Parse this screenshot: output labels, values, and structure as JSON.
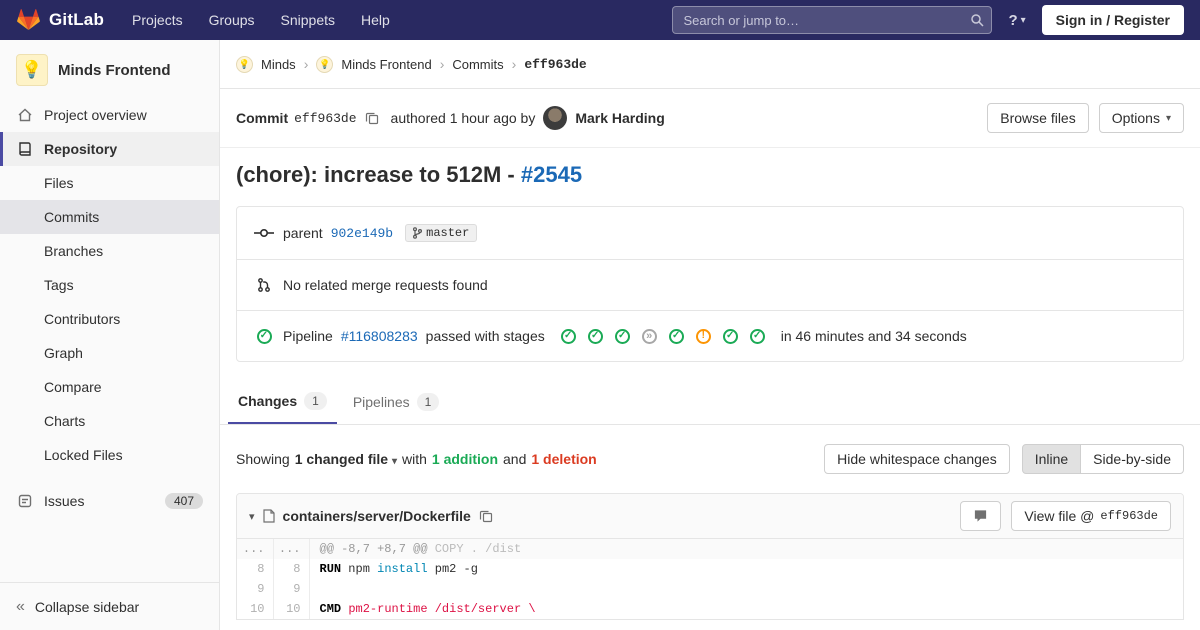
{
  "icons": {
    "caret_down": "▾",
    "collapse": "«",
    "help": "?"
  },
  "navbar": {
    "logo_text": "GitLab",
    "menu": [
      "Projects",
      "Groups",
      "Snippets",
      "Help"
    ],
    "search_placeholder": "Search or jump to…",
    "sign_in_label": "Sign in / Register"
  },
  "sidebar": {
    "project_avatar": "💡",
    "project_name": "Minds Frontend",
    "overview_label": "Project overview",
    "repository_label": "Repository",
    "repo_items": [
      "Files",
      "Commits",
      "Branches",
      "Tags",
      "Contributors",
      "Graph",
      "Compare",
      "Charts",
      "Locked Files"
    ],
    "active_repo_item": "Commits",
    "issues_label": "Issues",
    "issues_count": "407",
    "collapse_label": "Collapse sidebar"
  },
  "breadcrumb": {
    "avatar_glyph": "💡",
    "items": [
      "Minds",
      "Minds Frontend",
      "Commits"
    ],
    "current": "eff963de",
    "separator": "›"
  },
  "commit": {
    "label": "Commit",
    "sha": "eff963de",
    "authored_text": "authored 1 hour ago by",
    "author": "Mark Harding",
    "browse_files_label": "Browse files",
    "options_label": "Options",
    "title": "(chore): increase to 512M - ",
    "title_link": "#2545",
    "parent_label": "parent",
    "parent_sha": "902e149b",
    "branch_ref": "master",
    "no_mr_text": "No related merge requests found",
    "pipeline": {
      "status_glyph": "✓",
      "prefix": "Pipeline",
      "id": "#116808283",
      "status_text": "passed with stages",
      "stages": [
        {
          "status": "passed",
          "glyph": "✓"
        },
        {
          "status": "passed",
          "glyph": "✓"
        },
        {
          "status": "passed",
          "glyph": "✓"
        },
        {
          "status": "skipped",
          "glyph": "»"
        },
        {
          "status": "passed",
          "glyph": "✓"
        },
        {
          "status": "warning",
          "glyph": "!"
        },
        {
          "status": "passed",
          "glyph": "✓"
        },
        {
          "status": "passed",
          "glyph": "✓"
        }
      ],
      "duration": "in 46 minutes and 34 seconds"
    }
  },
  "tabs": {
    "changes_label": "Changes",
    "changes_count": "1",
    "pipelines_label": "Pipelines",
    "pipelines_count": "1"
  },
  "controls": {
    "showing": "Showing",
    "changed_files": "1 changed file",
    "with": "with",
    "additions": "1 addition",
    "and": "and",
    "deletions": "1 deletion",
    "hide_whitespace_label": "Hide whitespace changes",
    "inline_label": "Inline",
    "side_by_side_label": "Side-by-side"
  },
  "diff": {
    "file_path": "containers/server/Dockerfile",
    "view_file_prefix": "View file @",
    "view_file_sha": "eff963de",
    "rows": [
      {
        "old": "...",
        "new": "...",
        "hunk": "@@ -8,7 +8,7 @@",
        "hunk_context": " COPY . /dist"
      },
      {
        "old": "8",
        "new": "8",
        "kw": "RUN",
        "t1": " npm ",
        "fn": "install",
        "t2": " pm2 -g"
      },
      {
        "old": "9",
        "new": "9"
      },
      {
        "old": "10",
        "new": "10",
        "kw": "CMD",
        "t1": " ",
        "str": "pm2-runtime /dist/server \\"
      }
    ]
  }
}
